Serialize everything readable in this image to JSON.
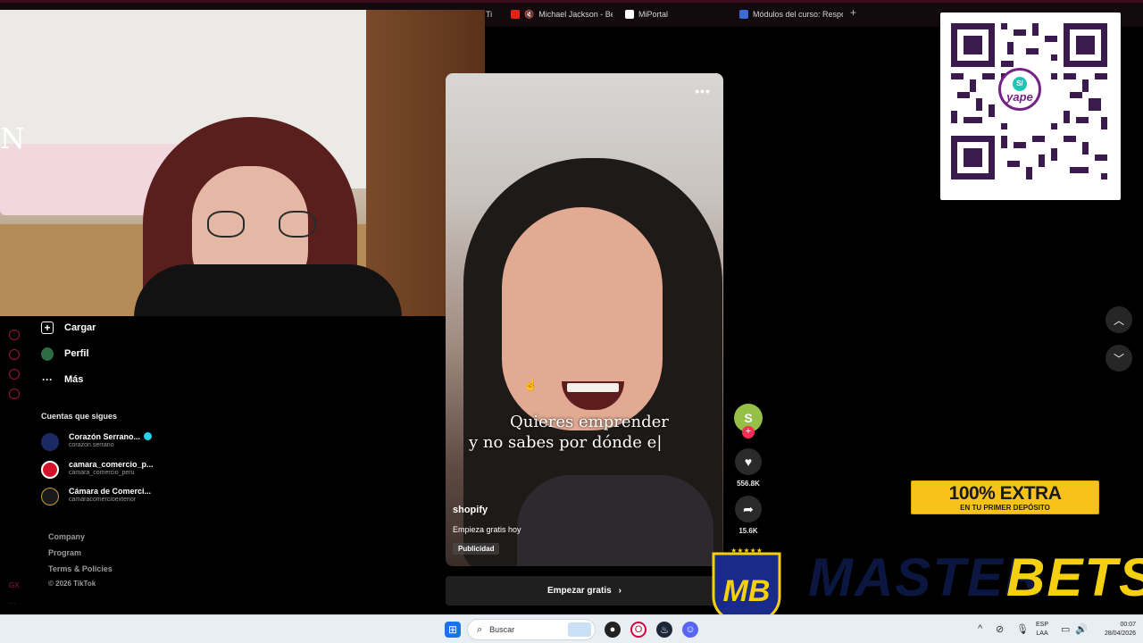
{
  "browser": {
    "tabs": [
      {
        "label": "Ti",
        "icon": "tab-icon"
      },
      {
        "label": "Michael Jackson - Bea",
        "icon": "youtube-icon",
        "muted": true
      },
      {
        "label": "MiPortal",
        "icon": "portal-icon"
      },
      {
        "label": "Módulos del curso: Respo",
        "icon": "course-icon"
      }
    ],
    "accent_color": "#3b0d1b"
  },
  "webcam": {
    "overlay_letter": "N"
  },
  "sidebar": {
    "nav": [
      {
        "label": "Cargar",
        "icon": "upload-icon"
      },
      {
        "label": "Perfil",
        "icon": "profile-avatar"
      },
      {
        "label": "Más",
        "icon": "more-icon"
      }
    ],
    "following_title": "Cuentas que sigues",
    "accounts": [
      {
        "name": "Corazón Serrano...",
        "handle": "corazon.serrano",
        "verified": true,
        "color": "#1b2a63"
      },
      {
        "name": "camara_comercio_p...",
        "handle": "camara_comercio_peru",
        "verified": false,
        "color": "#d3132a"
      },
      {
        "name": "Cámara de Comerci...",
        "handle": "camaracomercioexterior",
        "verified": false,
        "color": "#1a1a1a"
      }
    ],
    "footer_links": [
      "Company",
      "Program",
      "Terms & Policies"
    ],
    "copyright": "© 2026 TikTok",
    "rail_label": "GX"
  },
  "video": {
    "caption_line1": "Quieres emprender",
    "caption_line2": "y no sabes por dónde e|",
    "author": "shopify",
    "description": "Empieza gratis hoy",
    "badge": "Publicidad",
    "cta_label": "Empezar gratis",
    "more_label": "•••"
  },
  "actions": {
    "likes": "556.8K",
    "shares": "15.6K",
    "brand_color": "#95bf47"
  },
  "promo": {
    "headline": "100% EXTRA",
    "subline": "EN TU PRIMER DEPÓSITO",
    "brand_left": "MASTER",
    "brand_right": "BETS",
    "logo_text": "MB",
    "stars": "★★★★★"
  },
  "qr": {
    "brand": "yape",
    "symbol": "S/"
  },
  "taskbar": {
    "search_placeholder": "Buscar",
    "lang_line1": "ESP",
    "lang_line2": "LAA",
    "time": "00:07",
    "date": "28/04/2026"
  }
}
